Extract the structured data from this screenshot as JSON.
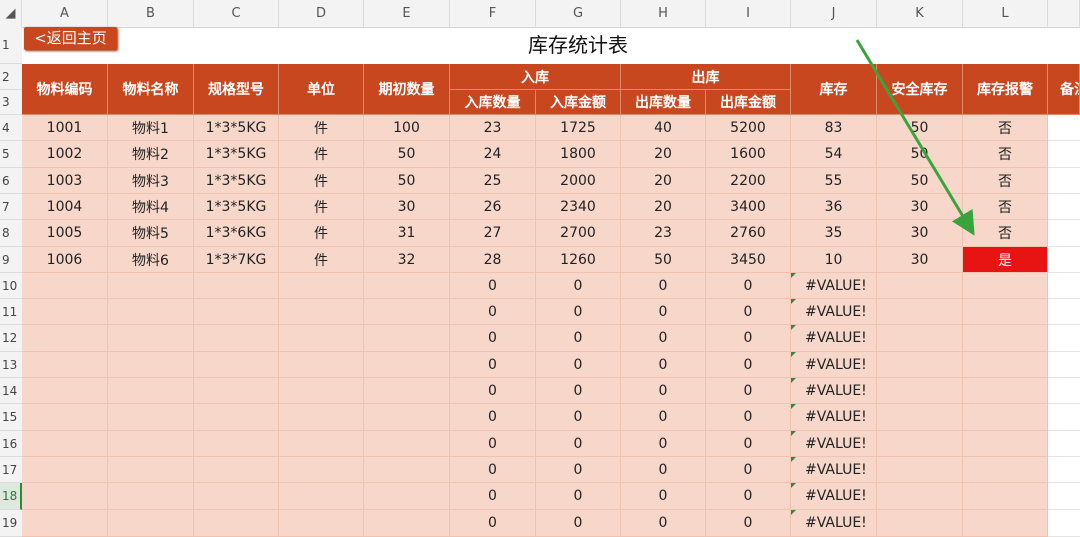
{
  "columns": [
    "◢",
    "A",
    "B",
    "C",
    "D",
    "E",
    "F",
    "G",
    "H",
    "I",
    "J",
    "K",
    "L",
    ""
  ],
  "rows": [
    "1",
    "2",
    "3",
    "4",
    "5",
    "6",
    "7",
    "8",
    "9",
    "10",
    "11",
    "12",
    "13",
    "14",
    "15",
    "16",
    "17",
    "18",
    "19"
  ],
  "back_button": "<返回主页",
  "title": "库存统计表",
  "headers": {
    "code": "物料编码",
    "name": "物料名称",
    "spec": "规格型号",
    "unit": "单位",
    "opening": "期初数量",
    "inbound": "入库",
    "in_qty": "入库数量",
    "in_amt": "入库金额",
    "outbound": "出库",
    "out_qty": "出库数量",
    "out_amt": "出库金额",
    "stock": "库存",
    "safety": "安全库存",
    "alarm": "库存报警",
    "remark": "备注"
  },
  "data_rows": [
    {
      "code": "1001",
      "name": "物料1",
      "spec": "1*3*5KG",
      "unit": "件",
      "opening": "100",
      "in_qty": "23",
      "in_amt": "1725",
      "out_qty": "40",
      "out_amt": "5200",
      "stock": "83",
      "safety": "50",
      "alarm": "否"
    },
    {
      "code": "1002",
      "name": "物料2",
      "spec": "1*3*5KG",
      "unit": "件",
      "opening": "50",
      "in_qty": "24",
      "in_amt": "1800",
      "out_qty": "20",
      "out_amt": "1600",
      "stock": "54",
      "safety": "50",
      "alarm": "否"
    },
    {
      "code": "1003",
      "name": "物料3",
      "spec": "1*3*5KG",
      "unit": "件",
      "opening": "50",
      "in_qty": "25",
      "in_amt": "2000",
      "out_qty": "20",
      "out_amt": "2200",
      "stock": "55",
      "safety": "50",
      "alarm": "否"
    },
    {
      "code": "1004",
      "name": "物料4",
      "spec": "1*3*5KG",
      "unit": "件",
      "opening": "30",
      "in_qty": "26",
      "in_amt": "2340",
      "out_qty": "20",
      "out_amt": "3400",
      "stock": "36",
      "safety": "30",
      "alarm": "否"
    },
    {
      "code": "1005",
      "name": "物料5",
      "spec": "1*3*6KG",
      "unit": "件",
      "opening": "31",
      "in_qty": "27",
      "in_amt": "2700",
      "out_qty": "23",
      "out_amt": "2760",
      "stock": "35",
      "safety": "30",
      "alarm": "否"
    },
    {
      "code": "1006",
      "name": "物料6",
      "spec": "1*3*7KG",
      "unit": "件",
      "opening": "32",
      "in_qty": "28",
      "in_amt": "1260",
      "out_qty": "50",
      "out_amt": "3450",
      "stock": "10",
      "safety": "30",
      "alarm": "是"
    }
  ],
  "empty_rows": [
    {
      "in_qty": "0",
      "in_amt": "0",
      "out_qty": "0",
      "out_amt": "0",
      "stock": "#VALUE!"
    },
    {
      "in_qty": "0",
      "in_amt": "0",
      "out_qty": "0",
      "out_amt": "0",
      "stock": "#VALUE!"
    },
    {
      "in_qty": "0",
      "in_amt": "0",
      "out_qty": "0",
      "out_amt": "0",
      "stock": "#VALUE!"
    },
    {
      "in_qty": "0",
      "in_amt": "0",
      "out_qty": "0",
      "out_amt": "0",
      "stock": "#VALUE!"
    },
    {
      "in_qty": "0",
      "in_amt": "0",
      "out_qty": "0",
      "out_amt": "0",
      "stock": "#VALUE!"
    },
    {
      "in_qty": "0",
      "in_amt": "0",
      "out_qty": "0",
      "out_amt": "0",
      "stock": "#VALUE!"
    },
    {
      "in_qty": "0",
      "in_amt": "0",
      "out_qty": "0",
      "out_amt": "0",
      "stock": "#VALUE!"
    },
    {
      "in_qty": "0",
      "in_amt": "0",
      "out_qty": "0",
      "out_amt": "0",
      "stock": "#VALUE!"
    },
    {
      "in_qty": "0",
      "in_amt": "0",
      "out_qty": "0",
      "out_amt": "0",
      "stock": "#VALUE!"
    },
    {
      "in_qty": "0",
      "in_amt": "0",
      "out_qty": "0",
      "out_amt": "0",
      "stock": "#VALUE!"
    }
  ],
  "colors": {
    "header": "#c8471f",
    "body": "#f8d7cb",
    "alarm": "#e81414",
    "arrow": "#3aa43c"
  }
}
